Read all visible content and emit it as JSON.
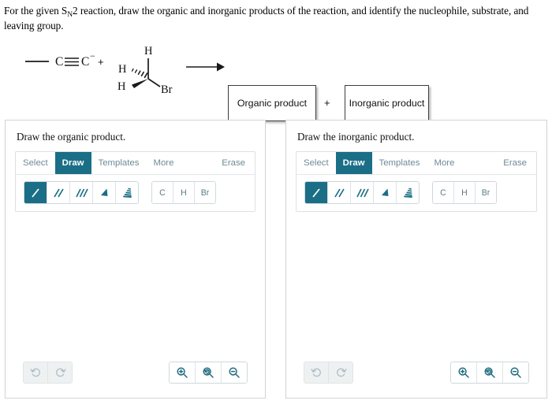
{
  "prompt": {
    "part1": "For the given S",
    "sub": "N",
    "part2": "2 reaction, draw the organic and inorganic products of the reaction, and identify the nucleophile, substrate, and leaving group."
  },
  "reaction": {
    "reactant_alkyne": {
      "atom1": "C",
      "atom2": "C",
      "charge": "−"
    },
    "plus_reactants": "+",
    "reactant_halide": {
      "h_top": "H",
      "h_hashed": "H",
      "h_wedge": "H",
      "leaving_group": "Br"
    },
    "arrow": "reaction-arrow",
    "organic_product_box": "Organic product",
    "plus_products": "+",
    "inorganic_product_box": "Inorganic product"
  },
  "panels": [
    {
      "title": "Draw the organic product.",
      "toolbar": {
        "tabs": [
          {
            "label": "Select",
            "active": false
          },
          {
            "label": "Draw",
            "active": true
          },
          {
            "label": "Templates",
            "active": false
          },
          {
            "label": "More",
            "active": false
          }
        ],
        "erase_label": "Erase",
        "bond_tools": [
          {
            "name": "single-bond-tool",
            "selected": true
          },
          {
            "name": "double-bond-tool",
            "selected": false
          },
          {
            "name": "triple-bond-tool",
            "selected": false
          },
          {
            "name": "wedge-bond-tool",
            "selected": false
          },
          {
            "name": "hash-bond-tool",
            "selected": false
          }
        ],
        "atom_tools": [
          "C",
          "H",
          "Br"
        ]
      },
      "bottom": {
        "undo": "undo-icon",
        "redo": "redo-icon",
        "zoom_in": "zoom-in-icon",
        "zoom_reset": "zoom-reset-icon",
        "zoom_out": "zoom-out-icon"
      }
    },
    {
      "title": "Draw the inorganic product.",
      "toolbar": {
        "tabs": [
          {
            "label": "Select",
            "active": false
          },
          {
            "label": "Draw",
            "active": true
          },
          {
            "label": "Templates",
            "active": false
          },
          {
            "label": "More",
            "active": false
          }
        ],
        "erase_label": "Erase",
        "bond_tools": [
          {
            "name": "single-bond-tool",
            "selected": true
          },
          {
            "name": "double-bond-tool",
            "selected": false
          },
          {
            "name": "triple-bond-tool",
            "selected": false
          },
          {
            "name": "wedge-bond-tool",
            "selected": false
          },
          {
            "name": "hash-bond-tool",
            "selected": false
          }
        ],
        "atom_tools": [
          "C",
          "H",
          "Br"
        ]
      },
      "bottom": {
        "undo": "undo-icon",
        "redo": "redo-icon",
        "zoom_in": "zoom-in-icon",
        "zoom_reset": "zoom-reset-icon",
        "zoom_out": "zoom-out-icon"
      }
    }
  ],
  "colors": {
    "accent": "#1a6e86",
    "tab_text": "#6e8b94",
    "panel_border": "#d0d3d6",
    "box_border": "#3d3d3d"
  }
}
